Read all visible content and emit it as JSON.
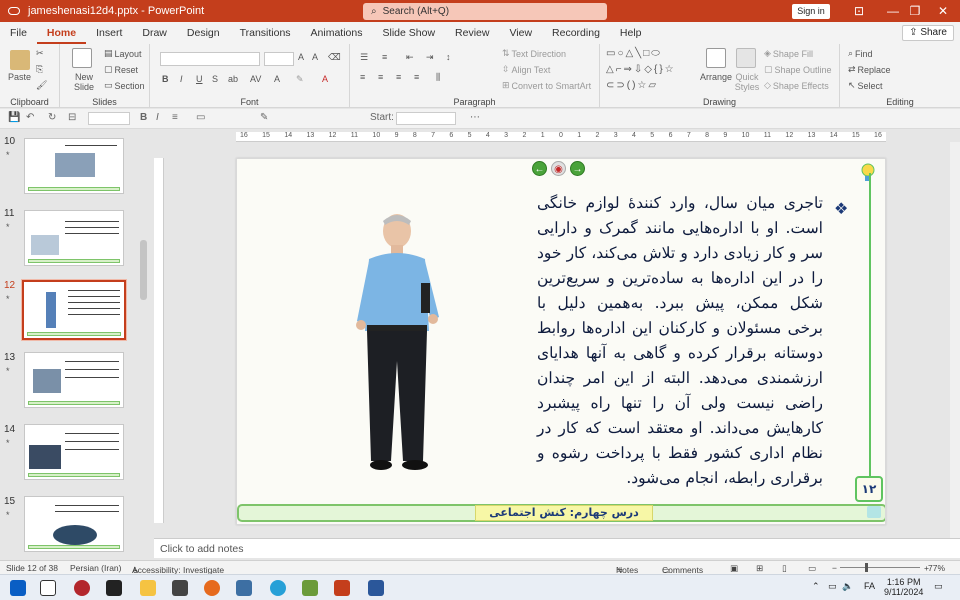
{
  "window": {
    "filename": "jameshenasi12d4.pptx",
    "app": "PowerPoint",
    "title_separator": "-",
    "search_placeholder": "Search (Alt+Q)",
    "sign_in": "Sign in",
    "accent_color": "#c43e1c"
  },
  "tabs": [
    "File",
    "Home",
    "Insert",
    "Draw",
    "Design",
    "Transitions",
    "Animations",
    "Slide Show",
    "Review",
    "View",
    "Recording",
    "Help"
  ],
  "active_tab": "Home",
  "share_label": "Share",
  "ribbon": {
    "clipboard": {
      "paste": "Paste",
      "label": "Clipboard"
    },
    "slides": {
      "new_slide": "New Slide",
      "layout": "Layout",
      "reset": "Reset",
      "section": "Section",
      "label": "Slides"
    },
    "font": {
      "label": "Font",
      "bold": "B",
      "italic": "I",
      "underline": "U",
      "strike": "S",
      "aa": "A",
      "ab": "ab"
    },
    "paragraph": {
      "label": "Paragraph",
      "text_direction": "Text Direction",
      "align_text": "Align Text",
      "convert_smartart": "Convert to SmartArt"
    },
    "drawing": {
      "label": "Drawing",
      "arrange": "Arrange",
      "quick_styles": "Quick Styles",
      "shape_fill": "Shape Fill",
      "shape_outline": "Shape Outline",
      "shape_effects": "Shape Effects"
    },
    "editing": {
      "label": "Editing",
      "find": "Find",
      "replace": "Replace",
      "select": "Select"
    }
  },
  "qat2": {
    "start": "Start:"
  },
  "thumbnails": [
    {
      "number": "10",
      "star": "*"
    },
    {
      "number": "11",
      "star": "*"
    },
    {
      "number": "12",
      "star": "*",
      "selected": true
    },
    {
      "number": "13",
      "star": "*"
    },
    {
      "number": "14",
      "star": "*"
    },
    {
      "number": "15",
      "star": "*"
    }
  ],
  "ruler_numbers": [
    "16",
    "15",
    "14",
    "13",
    "12",
    "11",
    "10",
    "9",
    "8",
    "7",
    "6",
    "5",
    "4",
    "3",
    "2",
    "1",
    "0",
    "1",
    "2",
    "3",
    "4",
    "5",
    "6",
    "7",
    "8",
    "9",
    "10",
    "11",
    "12",
    "13",
    "14",
    "15",
    "16"
  ],
  "slide": {
    "bullet": "❖",
    "body": "تاجری میان سال، وارد کنندهٔ لوازم خانگی است. او با اداره‌هایی مانند گمرک و دارایی سر و کار زیادی دارد و تلاش می‌کند، کار خود را در این اداره‌ها به ساده‌ترین و سریع‌ترین شکل ممکن، پیش ببرد. به‌همین دلیل با برخی مسئولان و کارکنان این اداره‌ها روابط دوستانه برقرار کرده و گاهی به آنها هدایای ارزشمندی می‌دهد. البته از این امر چندان راضی نیست ولی آن را تنها راه پیشبرد کارهایش می‌داند. او معتقد است که کار در نظام اداری کشور فقط با پرداخت رشوه و برقراری رابطه، انجام می‌شود.",
    "page_number": "۱۲",
    "footer_title": "درس چهارم: کنش اجتماعی"
  },
  "notes_placeholder": "Click to add notes",
  "status": {
    "slide_of": "Slide 12 of 38",
    "language": "Persian (Iran)",
    "accessibility": "Accessibility: Investigate",
    "notes": "Notes",
    "comments": "Comments",
    "zoom": "77%"
  },
  "taskbar": {
    "time": "1:16 PM",
    "date": "9/11/2024",
    "lang": "FA"
  }
}
